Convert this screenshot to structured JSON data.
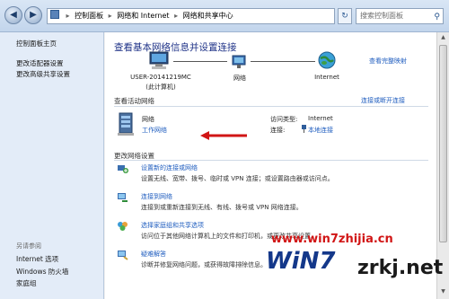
{
  "addressbar": {
    "crumbs": [
      "控制面板",
      "网络和 Internet",
      "网络和共享中心"
    ],
    "search_placeholder": "搜索控制面板"
  },
  "leftpane": {
    "home": "控制面板主页",
    "items": [
      "更改适配器设置",
      "更改高级共享设置"
    ],
    "see_also_label": "另请参阅",
    "see_also": [
      "Internet 选项",
      "Windows 防火墙",
      "家庭组"
    ]
  },
  "main": {
    "title": "查看基本网络信息并设置连接",
    "full_map": "查看完整映射",
    "map": {
      "computer": "USER-20141219MC",
      "computer_sub": "(此计算机)",
      "network": "网络",
      "internet": "Internet"
    },
    "active_header": "查看活动网络",
    "connect_disconnect": "连接或断开连接",
    "active_network": {
      "name": "网络",
      "type": "工作网络",
      "access_label": "访问类型:",
      "access_value": "Internet",
      "conn_label": "连接:",
      "conn_value": "本地连接"
    },
    "change_header": "更改网络设置",
    "tasks": [
      {
        "title": "设置新的连接或网络",
        "desc": "设置无线、宽带、拨号、临时或 VPN 连接；或设置路由器或访问点。"
      },
      {
        "title": "连接到网络",
        "desc": "连接到或重新连接到无线、有线、拨号或 VPN 网络连接。"
      },
      {
        "title": "选择家庭组和共享选项",
        "desc": "访问位于其他网络计算机上的文件和打印机，或更改共享设置。"
      },
      {
        "title": "疑难解答",
        "desc": "诊断并修复网络问题，或获得故障排除信息。"
      }
    ]
  },
  "watermark": {
    "url": "www.win7zhijia.cn",
    "logo": "WiN7",
    "site": "zrkj.net"
  },
  "colors": {
    "link": "#1f5dbf",
    "title": "#1e3287",
    "arrow": "#d11515"
  }
}
